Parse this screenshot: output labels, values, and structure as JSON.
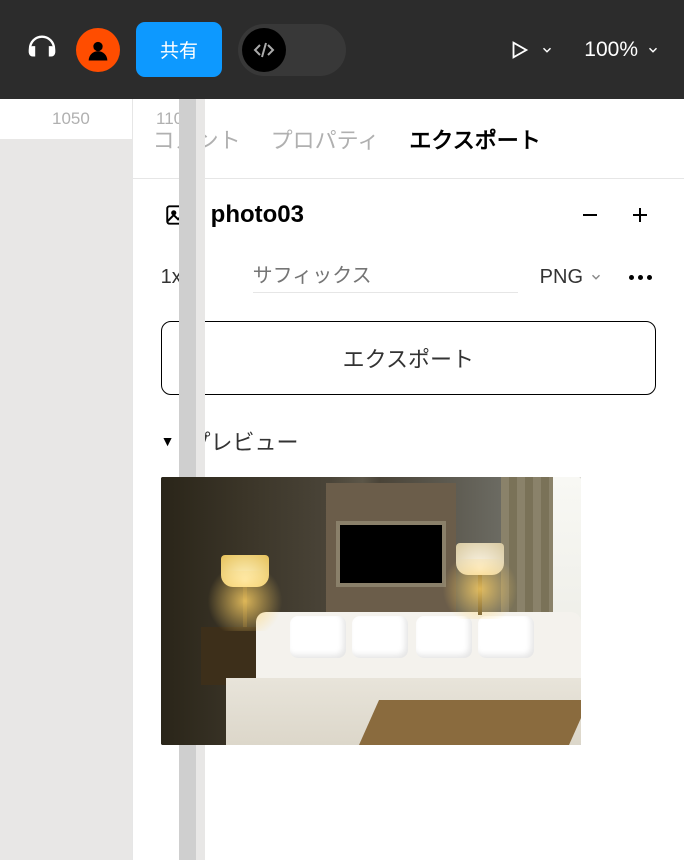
{
  "topbar": {
    "share_label": "共有",
    "zoom_value": "100%"
  },
  "ruler": {
    "ticks": [
      "1050",
      "1100"
    ]
  },
  "tabs": {
    "comment": "コメント",
    "property": "プロパティ",
    "export": "エクスポート"
  },
  "export": {
    "layer_name": "photo03",
    "scale": "1x",
    "suffix_placeholder": "サフィックス",
    "format": "PNG",
    "export_button": "エクスポート",
    "preview_label": "プレビュー"
  }
}
